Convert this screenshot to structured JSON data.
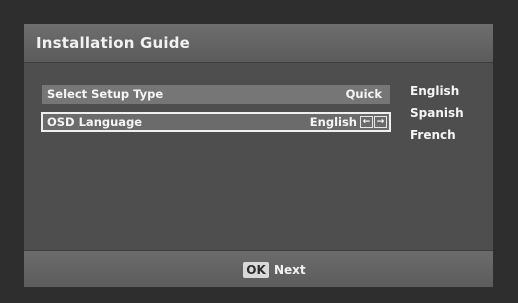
{
  "window": {
    "title": "Installation Guide"
  },
  "rows": [
    {
      "label": "Select Setup Type",
      "value": "Quick"
    },
    {
      "label": "OSD Language",
      "value": "English",
      "left_arrow": "←",
      "right_arrow": "→"
    }
  ],
  "language_options": [
    "English",
    "Spanish",
    "French"
  ],
  "footer": {
    "ok_key": "OK",
    "next_label": "Next"
  },
  "colors": {
    "panel": "#4e4e4e",
    "title_bar": "#656565",
    "row": "#767676",
    "selected_border": "#efefef"
  }
}
